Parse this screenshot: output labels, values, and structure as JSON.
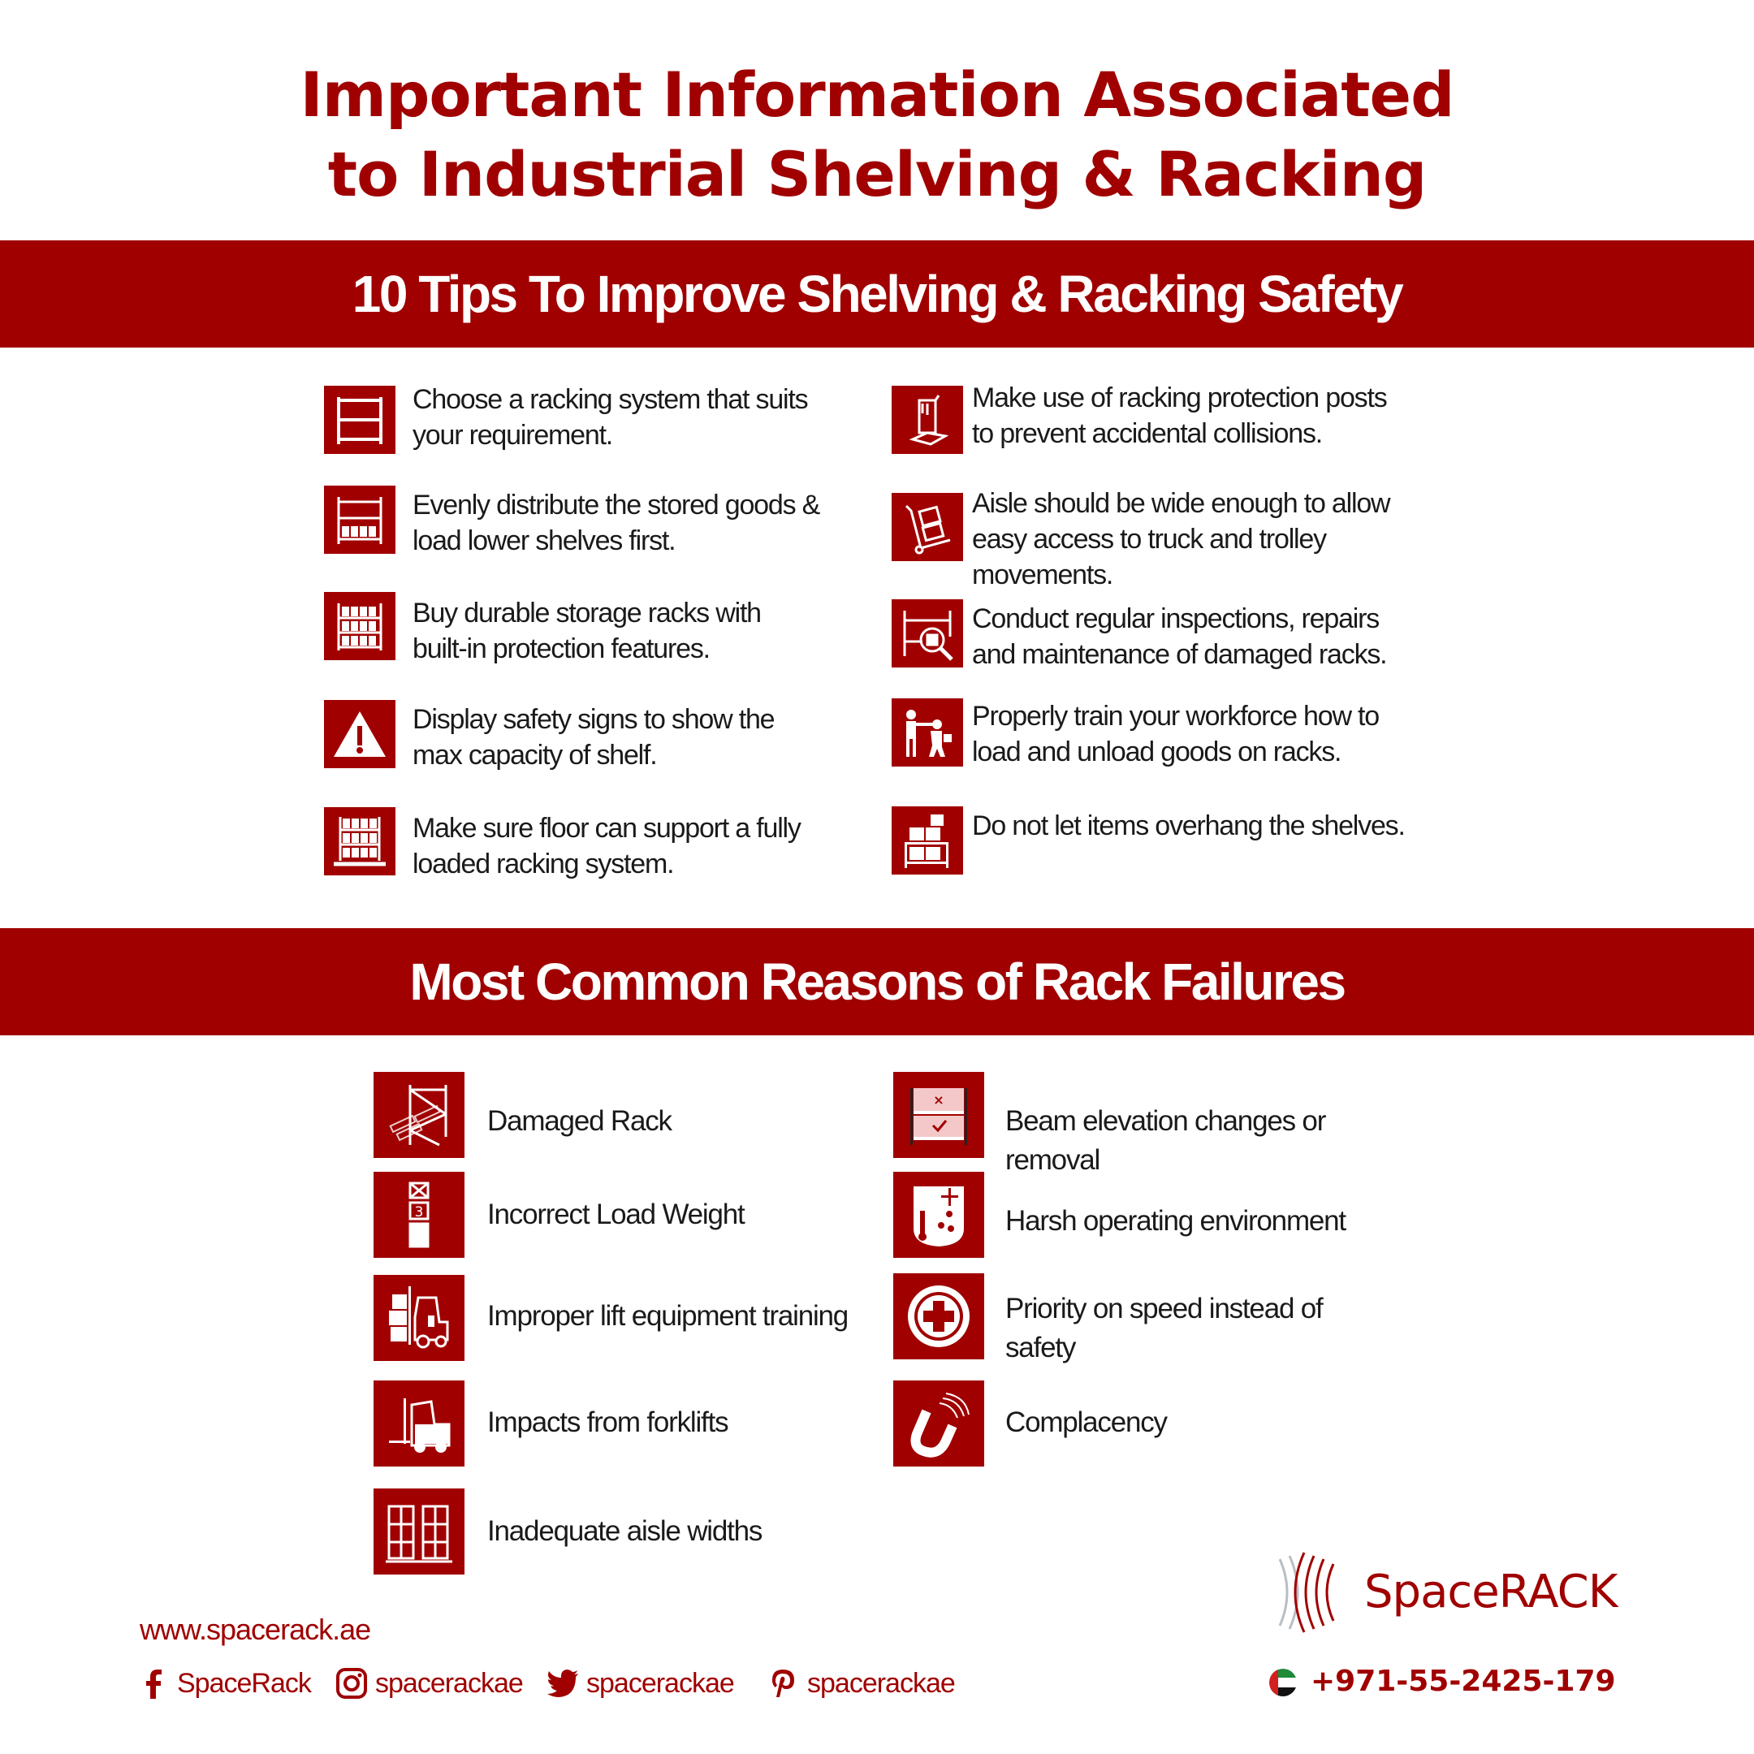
{
  "title": {
    "line1": "Important Information Associated",
    "line2": "to Industrial Shelving & Racking"
  },
  "colors": {
    "brand_red": "#a00000",
    "text": "#1a1a1a",
    "background": "#ffffff"
  },
  "tips_section": {
    "heading": "10 Tips To Improve Shelving & Racking Safety",
    "left": [
      {
        "icon": "rack-shelf-icon",
        "line1": "Choose a racking system that suits",
        "line2": "your requirement."
      },
      {
        "icon": "rack-loaded-bottom-icon",
        "line1": "Evenly distribute the stored goods &",
        "line2": "load lower shelves first."
      },
      {
        "icon": "rack-full-icon",
        "line1": "Buy durable storage racks with",
        "line2": "built-in protection features."
      },
      {
        "icon": "warning-triangle-icon",
        "line1": "Display safety signs to show the",
        "line2": "max capacity of shelf."
      },
      {
        "icon": "rack-floor-icon",
        "line1": "Make sure floor can support a fully",
        "line2": "loaded racking system."
      }
    ],
    "right": [
      {
        "icon": "protection-post-icon",
        "line1": "Make use of racking protection posts",
        "line2": "to prevent accidental collisions."
      },
      {
        "icon": "hand-truck-icon",
        "line1": "Aisle should be wide enough to allow",
        "line2": "easy access to truck and trolley",
        "line3": "movements."
      },
      {
        "icon": "rack-inspection-icon",
        "line1": "Conduct regular inspections, repairs",
        "line2": "and maintenance of damaged racks."
      },
      {
        "icon": "workforce-training-icon",
        "line1": "Properly train your workforce how to",
        "line2": "load and unload goods on racks."
      },
      {
        "icon": "overhang-boxes-icon",
        "line1": "Do not let items overhang the shelves."
      }
    ]
  },
  "failures_section": {
    "heading": "Most Common Reasons of Rack Failures",
    "left": [
      {
        "icon": "damaged-rack-icon",
        "line1": "Damaged Rack"
      },
      {
        "icon": "load-weight-icon",
        "line1": "Incorrect Load Weight"
      },
      {
        "icon": "forklift-boxes-icon",
        "line1": "Improper lift equipment training"
      },
      {
        "icon": "forklift-icon",
        "line1": "Impacts from forklifts"
      },
      {
        "icon": "aisle-racks-icon",
        "line1": "Inadequate aisle widths"
      }
    ],
    "right": [
      {
        "icon": "beam-elevation-icon",
        "line1": "Beam elevation changes  or",
        "line2": "removal"
      },
      {
        "icon": "harsh-environment-icon",
        "line1": "Harsh operating environment"
      },
      {
        "icon": "safety-first-icon",
        "line1": "Priority on speed instead of",
        "line2": "safety"
      },
      {
        "icon": "magnet-icon",
        "line1": "Complacency"
      }
    ]
  },
  "footer": {
    "website": "www.spacerack.ae",
    "social": [
      {
        "icon": "facebook-icon",
        "label": "SpaceRack"
      },
      {
        "icon": "instagram-icon",
        "label": "spacerackae"
      },
      {
        "icon": "twitter-icon",
        "label": "spacerackae"
      },
      {
        "icon": "pinterest-icon",
        "label": "spacerackae"
      }
    ],
    "brand_name": "SpaceRACK",
    "phone": "+971-55-2425-179",
    "phone_flag": "uae-flag-icon"
  }
}
